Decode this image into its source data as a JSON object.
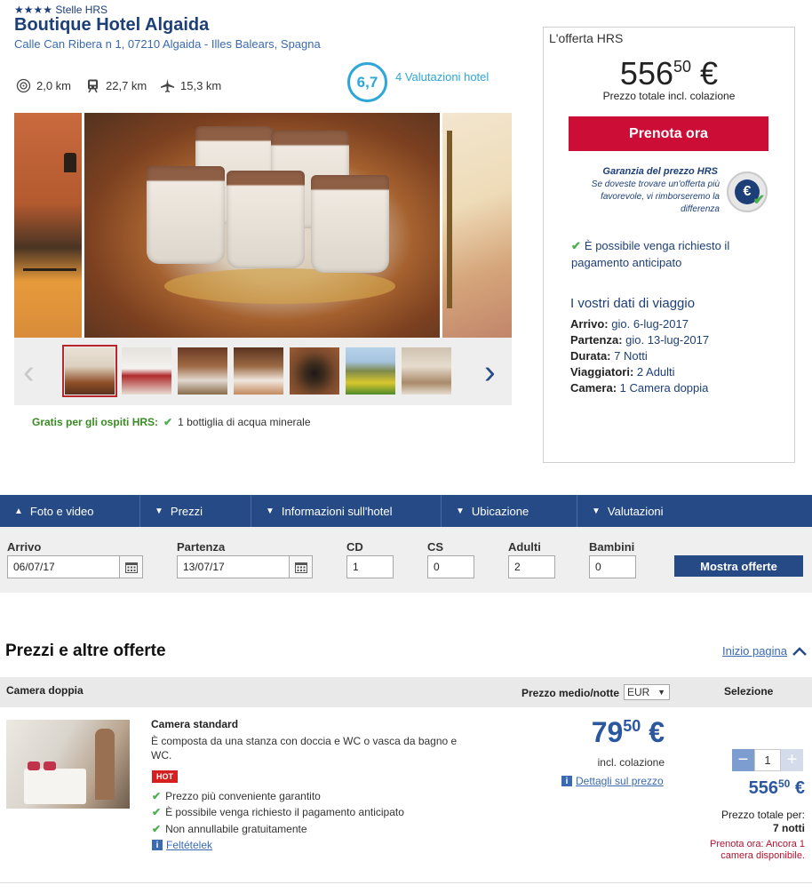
{
  "hotel": {
    "stars_icon": "★★★★",
    "stars_label": "Stelle HRS",
    "name": "Boutique Hotel Algaida",
    "address": "Calle Can Ribera n 1, 07210 Algaida - Illes Balears, Spagna",
    "distances": [
      {
        "icon": "target-icon",
        "value": "2,0 km"
      },
      {
        "icon": "train-icon",
        "value": "22,7 km"
      },
      {
        "icon": "plane-icon",
        "value": "15,3 km"
      }
    ],
    "rating": "6,7",
    "rating_label": "4 Valutazioni hotel",
    "gratis_label": "Gratis per gli ospiti HRS:",
    "gratis_value": "1 bottiglia di acqua minerale"
  },
  "offer": {
    "title": "L'offerta HRS",
    "price_int": "556",
    "price_dec": "50",
    "currency_symbol": "€",
    "price_sub": "Prezzo totale incl. colazione",
    "book_label": "Prenota ora",
    "guarantee_title": "Garanzia del prezzo HRS",
    "guarantee_text": "Se doveste trovare un'offerta più favorevole, vi rimborseremo la differenza",
    "prepay_note": "È possibile venga richiesto il pagamento anticipato",
    "trip_title": "I vostri dati di viaggio",
    "trip": [
      {
        "label": "Arrivo:",
        "value": "gio. 6-lug-2017"
      },
      {
        "label": "Partenza:",
        "value": "gio. 13-lug-2017"
      },
      {
        "label": "Durata:",
        "value": "7 Notti"
      },
      {
        "label": "Viaggiatori:",
        "value": "2 Adulti"
      },
      {
        "label": "Camera:",
        "value": "1 Camera doppia"
      }
    ]
  },
  "nav": {
    "items": [
      "Foto e video",
      "Prezzi",
      "Informazioni sull'hotel",
      "Ubicazione",
      "Valutazioni"
    ]
  },
  "search": {
    "arrival_label": "Arrivo",
    "arrival_value": "06/07/17",
    "departure_label": "Partenza",
    "departure_value": "13/07/17",
    "cd_label": "CD",
    "cd_value": "1",
    "cs_label": "CS",
    "cs_value": "0",
    "adults_label": "Adulti",
    "adults_value": "2",
    "children_label": "Bambini",
    "children_value": "0",
    "button": "Mostra offerte"
  },
  "prices": {
    "title": "Prezzi e altre offerte",
    "top_link": "Inizio pagina",
    "col_room": "Camera doppia",
    "col_avg": "Prezzo medio/notte",
    "currency": "EUR",
    "col_select": "Selezione",
    "room": {
      "name": "Camera standard",
      "desc": "È composta da una stanza con doccia e WC o vasca da bagno e WC.",
      "badge": "HOT",
      "features": [
        "Prezzo più conveniente garantito",
        "È possibile venga richiesto il pagamento anticipato",
        "Non annullabile gratuitamente"
      ],
      "terms_link": "Feltételek",
      "nightly_int": "79",
      "nightly_dec": "50",
      "nightly_currency": "€",
      "incl": "incl. colazione",
      "details_link": "Dettagli sul prezzo",
      "qty": "1",
      "total_int": "556",
      "total_dec": "50",
      "total_currency": "€",
      "total_label": "Prezzo totale per:",
      "total_nights": "7 notti",
      "availability": "Prenota ora: Ancora 1 camera disponibile."
    }
  },
  "colors": {
    "brand": "#254a86",
    "accent_red": "#cc0d35",
    "link": "#3a6ab0",
    "rating": "#2ea7d8",
    "check": "#4caf50"
  }
}
